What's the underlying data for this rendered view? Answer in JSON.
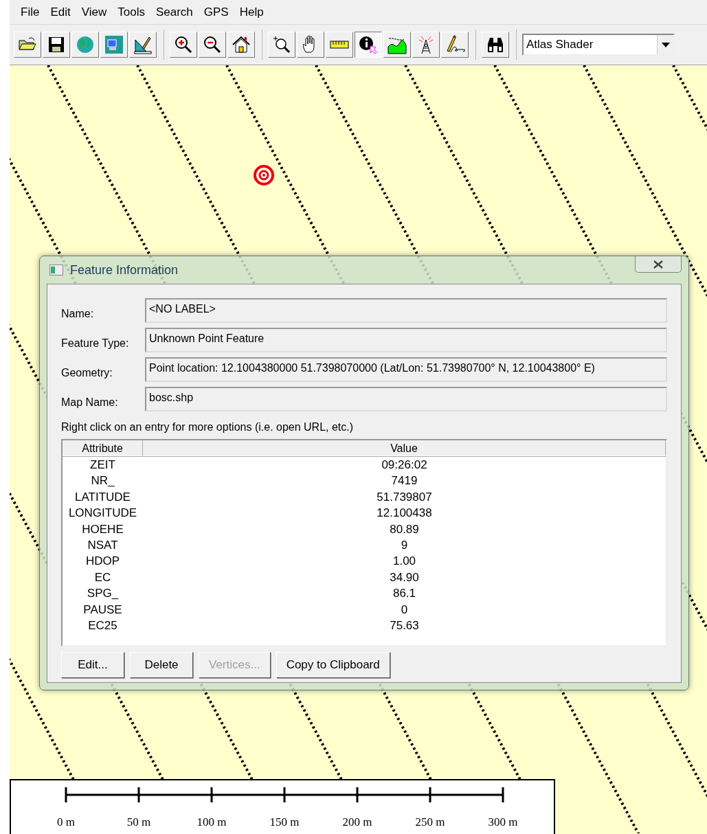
{
  "menu": [
    "File",
    "Edit",
    "View",
    "Tools",
    "Search",
    "GPS",
    "Help"
  ],
  "toolbar": {
    "groups": [
      [
        {
          "selected": false
        },
        {
          "selected": false
        },
        {
          "selected": false
        },
        {
          "selected": false
        },
        {
          "selected": false
        }
      ],
      [
        {
          "selected": false
        },
        {
          "selected": false
        },
        {
          "selected": false
        }
      ],
      [
        {
          "selected": false
        },
        {
          "selected": false
        },
        {
          "selected": false
        },
        {
          "selected": true
        },
        {
          "selected": false
        },
        {
          "selected": false
        },
        {
          "selected": false
        }
      ],
      [
        {
          "selected": false
        }
      ]
    ],
    "shader": "Atlas Shader"
  },
  "dialog": {
    "title": "Feature Information",
    "fields": [
      {
        "label": "Name:",
        "value": "<NO LABEL>"
      },
      {
        "label": "Feature Type:",
        "value": "Unknown Point Feature"
      },
      {
        "label": "Geometry:",
        "value": "Point location: 12.1004380000 51.7398070000 (Lat/Lon: 51.73980700° N, 12.10043800° E)"
      },
      {
        "label": "Map Name:",
        "value": "bosc.shp"
      }
    ],
    "hint": "Right click on an entry for more options (i.e. open URL, etc.)",
    "table": {
      "columns": [
        "Attribute",
        "Value"
      ],
      "rows": [
        [
          "ZEIT",
          "09:26:02"
        ],
        [
          "NR_",
          "7419"
        ],
        [
          "LATITUDE",
          "51.739807"
        ],
        [
          "LONGITUDE",
          "12.100438"
        ],
        [
          "HOEHE",
          "80.89"
        ],
        [
          "NSAT",
          "9"
        ],
        [
          "HDOP",
          "1.00"
        ],
        [
          "EC",
          "34.90"
        ],
        [
          "SPG_",
          "86.1"
        ],
        [
          "PAUSE",
          "0"
        ],
        [
          "EC25",
          "75.63"
        ]
      ]
    },
    "buttons": [
      {
        "label": "Edit...",
        "disabled": false
      },
      {
        "label": "Delete",
        "disabled": false
      },
      {
        "label": "Vertices...",
        "disabled": true
      },
      {
        "label": "Copy to Clipboard",
        "disabled": false
      }
    ]
  },
  "scale_bar": {
    "labels": [
      "0 m",
      "50 m",
      "100 m",
      "150 m",
      "200 m",
      "250 m",
      "300 m"
    ]
  }
}
